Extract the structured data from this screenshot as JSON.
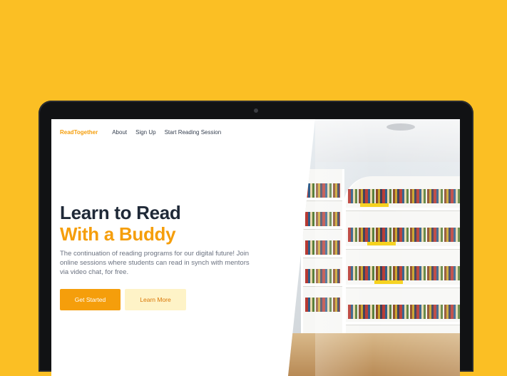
{
  "nav": {
    "brand": "ReadTogether",
    "links": [
      "About",
      "Sign Up",
      "Start Reading Session"
    ]
  },
  "hero": {
    "title_line1": "Learn to Read",
    "title_line2": "With a Buddy",
    "description": "The continuation of reading programs for our digital future! Join online sessions where students can read in synch with mentors via video chat, for free.",
    "primary_button": "Get Started",
    "secondary_button": "Learn More"
  },
  "colors": {
    "background": "#FBBF24",
    "accent": "#F59E0B",
    "secondary_button_bg": "#FEF3C7"
  },
  "image": {
    "subject": "library-bookshelves-photo"
  }
}
